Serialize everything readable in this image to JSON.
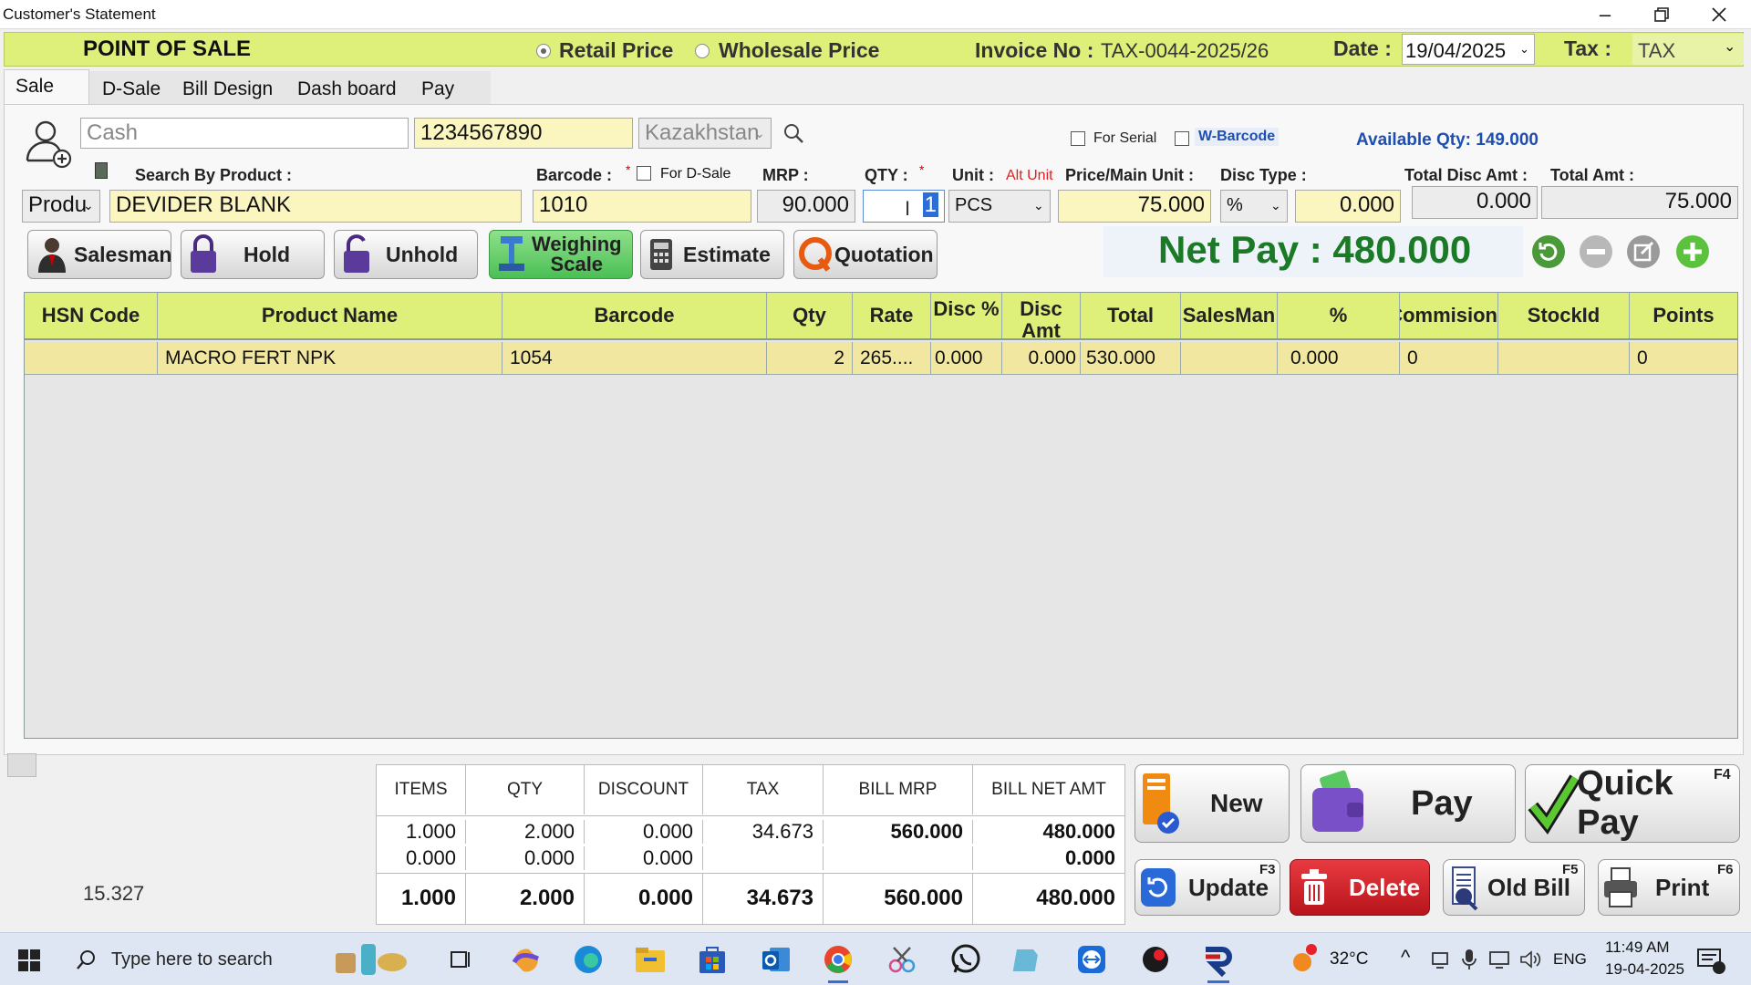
{
  "window": {
    "title": "Customer's Statement"
  },
  "header": {
    "app_title": "POINT OF SALE",
    "retail_price": "Retail Price",
    "wholesale_price": "Wholesale Price",
    "invoice_label": "Invoice No :",
    "invoice_no": "TAX-0044-2025/26",
    "date_label": "Date :",
    "date": "19/04/2025",
    "tax_label": "Tax :",
    "tax_value": "TAX"
  },
  "tabs": [
    "Sale",
    "D-Sale",
    "Bill Design",
    "Dash board",
    "Pay"
  ],
  "customer": {
    "name": "Cash",
    "phone": "1234567890",
    "country": "Kazakhstan"
  },
  "options": {
    "for_serial": "For Serial",
    "w_barcode": "W-Barcode",
    "available_qty": "Available Qty: 149.000"
  },
  "entry": {
    "search_label": "Search By Product :",
    "barcode_label": "Barcode :",
    "for_dsale": "For D-Sale",
    "mrp_label": "MRP :",
    "qty_label": "QTY :",
    "unit_label": "Unit :",
    "alt_unit": "Alt Unit",
    "price_label": "Price/Main Unit :",
    "disc_type_label": "Disc Type :",
    "total_disc_label": "Total Disc Amt :",
    "total_amt_label": "Total Amt :",
    "search_mode": "Produ",
    "product": "DEVIDER BLANK",
    "barcode": "1010",
    "mrp": "90.000",
    "qty": "1",
    "unit": "PCS",
    "price": "75.000",
    "disc_type": "%",
    "disc_value": "0.000",
    "total_disc": "0.000",
    "total_amt": "75.000"
  },
  "buttons": {
    "salesman": "Salesman",
    "hold": "Hold",
    "unhold": "Unhold",
    "weighing1": "Weighing",
    "weighing2": "Scale",
    "estimate": "Estimate",
    "quotation": "Quotation"
  },
  "net_pay": "Net Pay : 480.000",
  "grid": {
    "columns": [
      "HSN Code",
      "Product Name",
      "Barcode",
      "Qty",
      "Rate",
      "Disc %",
      "Disc Amt",
      "Total",
      "SalesMan",
      "%",
      "Commision",
      "StockId",
      "Points"
    ],
    "rows": [
      {
        "hsn": "",
        "product": "MACRO FERT NPK",
        "barcode": "1054",
        "qty": "2",
        "rate": "265....",
        "disc_pct": "0.000",
        "disc_amt": "0.000",
        "total": "530.000",
        "salesman": "",
        "pct": "0.000",
        "commission": "0",
        "stockid": "",
        "points": "0"
      }
    ]
  },
  "summary": {
    "headers": [
      "ITEMS",
      "QTY",
      "DISCOUNT",
      "TAX",
      "BILL MRP",
      "BILL NET AMT"
    ],
    "row1": [
      "1.000",
      "2.000",
      "0.000",
      "34.673",
      "560.000",
      "480.000"
    ],
    "row2": [
      "0.000",
      "0.000",
      "0.000",
      "",
      "",
      "0.000"
    ],
    "total": [
      "1.000",
      "2.000",
      "0.000",
      "34.673",
      "560.000",
      "480.000"
    ]
  },
  "side_value": "15.327",
  "actions": {
    "new": "New",
    "pay": "Pay",
    "quick_pay": "Quick Pay",
    "quick_pay_key": "F4",
    "update": "Update",
    "update_key": "F3",
    "delete": "Delete",
    "old_bill": "Old Bill",
    "old_bill_key": "F5",
    "print": "Print",
    "print_key": "F6"
  },
  "taskbar": {
    "search_placeholder": "Type here to search",
    "temperature": "32°C",
    "language": "ENG",
    "time": "11:49 AM",
    "date": "19-04-2025"
  },
  "colors": {
    "accent": "#dff07a",
    "net_pay": "#1a7a25",
    "delete": "#c8202a",
    "available_qty": "#1e4fb0"
  }
}
